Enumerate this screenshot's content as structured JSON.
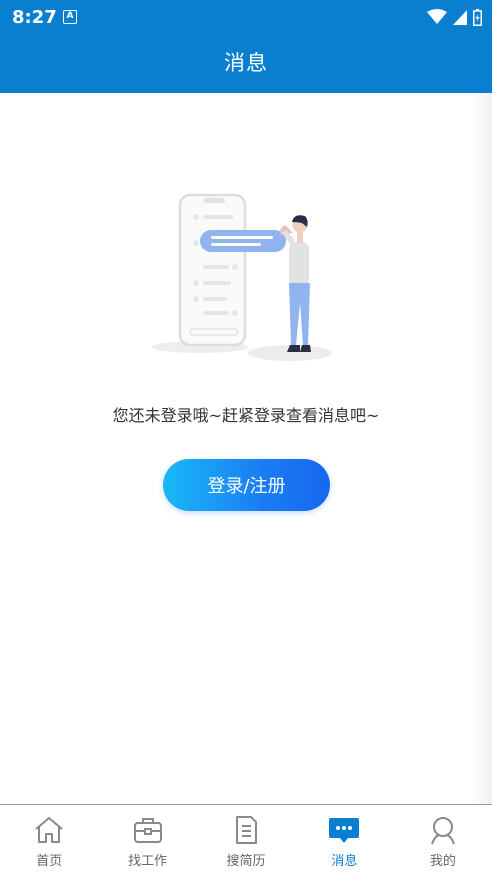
{
  "status_bar": {
    "time": "8:27",
    "app_icon_letter": "A",
    "icons": [
      "wifi-icon",
      "signal-icon",
      "battery-icon"
    ]
  },
  "header": {
    "title": "消息"
  },
  "main": {
    "illustration": "person-with-phone-illustration",
    "empty_message": "您还未登录哦~赶紧登录查看消息吧~",
    "login_button_label": "登录/注册"
  },
  "tabs": [
    {
      "label": "首页",
      "icon": "home-icon",
      "active": false
    },
    {
      "label": "找工作",
      "icon": "briefcase-icon",
      "active": false
    },
    {
      "label": "搜简历",
      "icon": "document-icon",
      "active": false
    },
    {
      "label": "消息",
      "icon": "message-icon",
      "active": true
    },
    {
      "label": "我的",
      "icon": "profile-icon",
      "active": false
    }
  ],
  "colors": {
    "primary": "#0a7fcf",
    "button_gradient_start": "#19b9f6",
    "button_gradient_end": "#1768ec",
    "tab_inactive": "#666666"
  }
}
